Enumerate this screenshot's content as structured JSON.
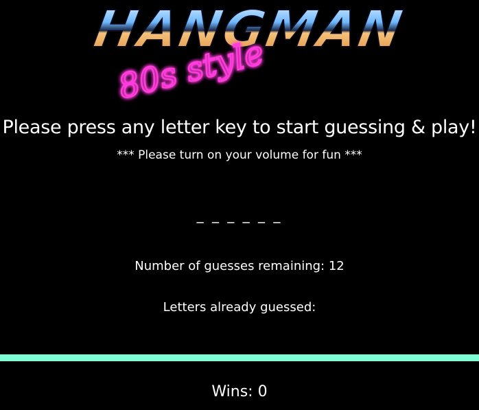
{
  "logo": {
    "title": "HANGMAN",
    "subtitle": "80s style",
    "icon": "hangman-80s-logo"
  },
  "game": {
    "instructions": "Please press any letter key to start guessing & play!",
    "volume_note": "*** Please turn on your volume for fun ***",
    "word_blanks": "_ _ _ _ _ _",
    "guesses_remaining_label": "Number of guesses remaining:",
    "guesses_remaining_value": "12",
    "letters_guessed_label": "Letters already guessed:",
    "letters_guessed_value": ""
  },
  "footer": {
    "wins_label": "Wins:",
    "wins_value": "0"
  },
  "colors": {
    "background": "#000000",
    "text": "#ffffff",
    "divider": "#7fffd4",
    "neon_pink": "#ff3cdc",
    "chrome_top": "#6fb8ff",
    "chrome_bottom": "#d98a3c"
  }
}
